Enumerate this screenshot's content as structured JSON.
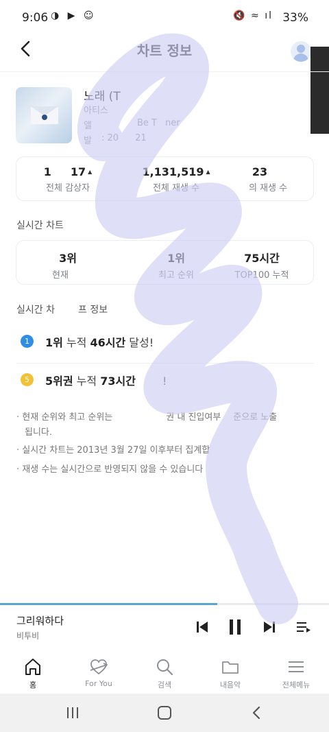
{
  "status_bar": {
    "time": "9:06",
    "left_icons": "◑ ▶ ☺",
    "right_icons": "🔇 ≈ ıl",
    "battery": "33%"
  },
  "header": {
    "title": "차트 정보",
    "back_icon": "chevron-left-icon",
    "profile_icon": "user-avatar-icon"
  },
  "song": {
    "title": "노래 (T",
    "artist": "아티스",
    "album": "앨",
    "album_suffix": "Be T",
    "album_suffix2": "ner",
    "release": "발",
    "release_suffix": ": 20",
    "release_suffix2": "21"
  },
  "stats": [
    {
      "value": "1",
      "value_tail": "17",
      "label": "전체 감상자",
      "trend": "▲"
    },
    {
      "value": "1,131,519",
      "label": "전체 재생 수",
      "trend": "▲"
    },
    {
      "value": "23",
      "label": "의 재생 수"
    }
  ],
  "realtime": {
    "section_label": "실시간 차트",
    "items": [
      {
        "value": "3위",
        "label": "현재"
      },
      {
        "value": "1위",
        "label": "최고 순위"
      },
      {
        "value": "75시간",
        "label": "TOP100 누적"
      }
    ]
  },
  "milestones": {
    "section_label": "실시간 차",
    "section_label_tail": "프 정보",
    "items": [
      {
        "badge": "1",
        "badge_color": "#2f8de4",
        "rank": "1위",
        "text_mid": " 누적 ",
        "hours": "46시간",
        "text_end": " 달성!"
      },
      {
        "badge": "5",
        "badge_color": "#f2c236",
        "rank": "5위권",
        "text_mid": " 누적 ",
        "hours": "73시간",
        "text_end": " !"
      }
    ]
  },
  "notes": [
    "· 현재 순위와 최고 순위는",
    "권 내 진입여부",
    "준으로 노출",
    "됩니다.",
    "· 실시간 차트는 2013년 3월 27일 이후부터 집계합",
    "· 재생 수는 실시간으로 반영되지 않을 수 있습니다"
  ],
  "player": {
    "title": "그리워하다",
    "artist": "비투비",
    "progress": 0.66
  },
  "bottom_nav": [
    {
      "label": "홈",
      "icon": "home-icon",
      "active": true
    },
    {
      "label": "For You",
      "icon": "heart-arrow-icon",
      "active": false
    },
    {
      "label": "검색",
      "icon": "search-icon",
      "active": false
    },
    {
      "label": "내음악",
      "icon": "folder-icon",
      "active": false
    },
    {
      "label": "전체메뉴",
      "icon": "menu-icon",
      "active": false
    }
  ],
  "colors": {
    "accent": "#5aa3d6",
    "scribble": "#ccccf3"
  }
}
